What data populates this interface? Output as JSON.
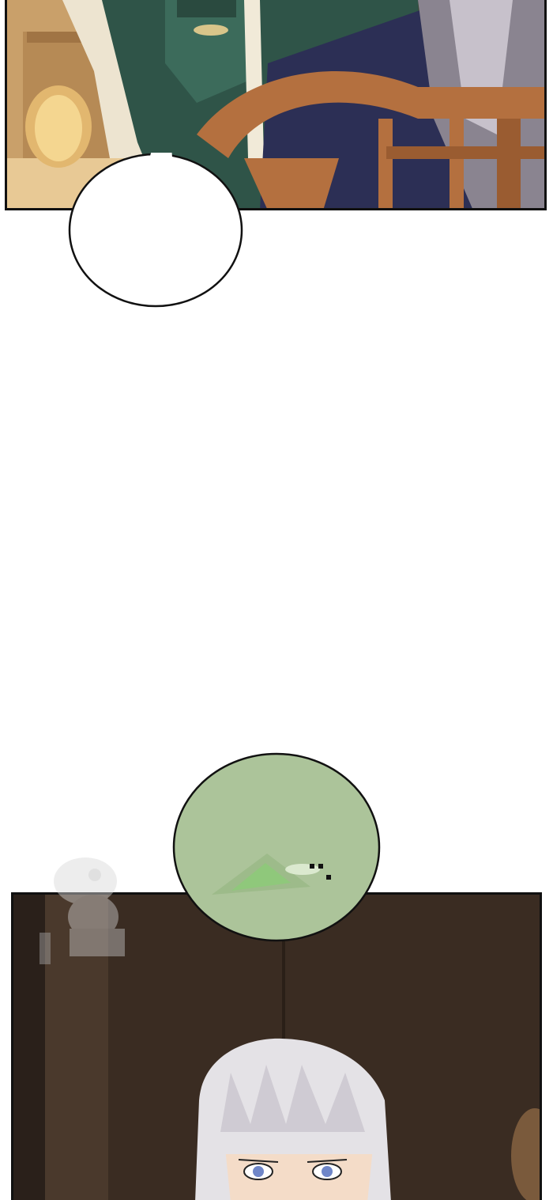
{
  "panels": [
    {
      "name": "top-panel",
      "scene": "throne-room"
    },
    {
      "name": "bottom-panel",
      "scene": "character-closeup"
    }
  ],
  "speech_bubble": {
    "text": ""
  },
  "sfx_bubble": {
    "text": ""
  },
  "colors": {
    "panel_border": "#111111",
    "green_bubble": "#acc49a",
    "robe_green": "#2f5448",
    "chair_brown": "#b4703f",
    "hair_silver": "#e4e2e6",
    "eye_blue": "#6f86c8"
  }
}
